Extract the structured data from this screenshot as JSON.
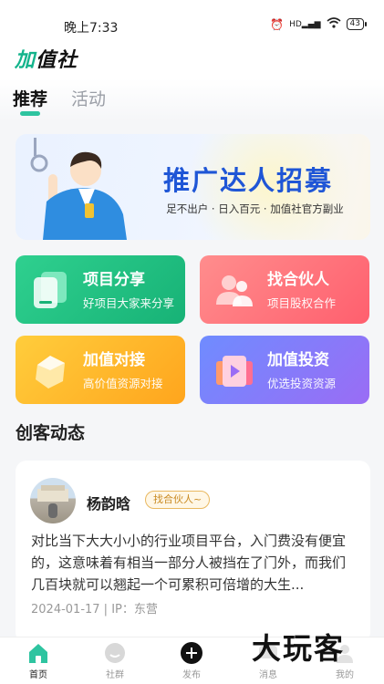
{
  "status_bar": {
    "time": "晚上7:33",
    "battery": "43",
    "network": "HD"
  },
  "header": {
    "logo_accent": "加",
    "logo_rest": "值社"
  },
  "tabs": {
    "recommend": "推荐",
    "activity": "活动"
  },
  "banner": {
    "title": "推广达人招募",
    "subtitle": "足不出户 · 日入百元 · 加值社官方副业"
  },
  "cards": [
    {
      "title": "项目分享",
      "subtitle": "好项目大家来分享"
    },
    {
      "title": "找合伙人",
      "subtitle": "项目股权合作"
    },
    {
      "title": "加值对接",
      "subtitle": "高价值资源对接"
    },
    {
      "title": "加值投资",
      "subtitle": "优选投资资源"
    }
  ],
  "section": {
    "title": "创客动态"
  },
  "post": {
    "author": "杨韵晗",
    "badge": "找合伙人~",
    "text": "对比当下大大小小的行业项目平台，入门费没有便宜的，这意味着有相当一部分人被挡在了门外，而我们几百块就可以翘起一个可累积可倍增的大生...",
    "meta": "2024-01-17  |  IP：东营"
  },
  "tabbar": [
    {
      "label": "首页",
      "icon": "home-icon"
    },
    {
      "label": "社群",
      "icon": "community-icon"
    },
    {
      "label": "发布",
      "icon": "publish-icon"
    },
    {
      "label": "消息",
      "icon": "message-icon"
    },
    {
      "label": "我的",
      "icon": "profile-icon"
    }
  ],
  "watermark": "大玩客",
  "colors": {
    "accent": "#2ec4a0",
    "banner_title": "#1f56d6"
  }
}
